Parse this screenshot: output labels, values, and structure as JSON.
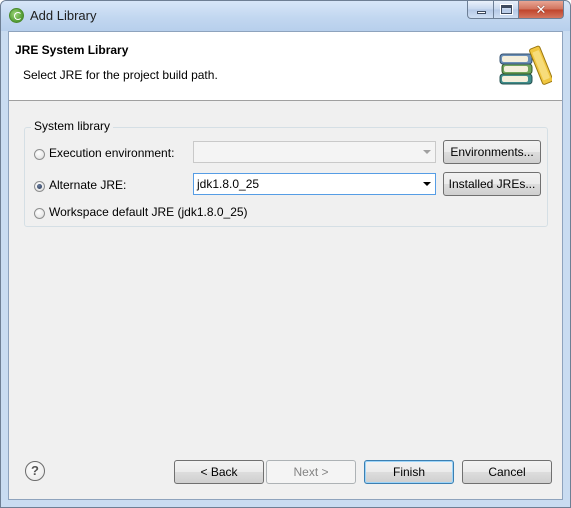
{
  "window": {
    "title": "Add Library",
    "close_glyph": "✕",
    "min_icon": "minimize-icon",
    "max_icon": "maximize-icon"
  },
  "header": {
    "title": "JRE System Library",
    "description": "Select JRE for the project build path.",
    "icon": "books-icon"
  },
  "group": {
    "label": "System library",
    "options": [
      {
        "label": "Execution environment:",
        "checked": false,
        "combo_value": "",
        "combo_enabled": false,
        "button_label": "Environments..."
      },
      {
        "label": "Alternate JRE:",
        "checked": true,
        "combo_value": "jdk1.8.0_25",
        "combo_enabled": true,
        "button_label": "Installed JREs..."
      },
      {
        "label": "Workspace default JRE (jdk1.8.0_25)",
        "checked": false
      }
    ]
  },
  "footer": {
    "help_glyph": "?",
    "back_label": "< Back",
    "next_label": "Next >",
    "finish_label": "Finish",
    "cancel_label": "Cancel"
  },
  "colors": {
    "titlebar": "#c2d7f0",
    "close_button": "#c0432a",
    "dialog_bg": "#f0f0f0",
    "focus_border": "#569de5",
    "default_button_border": "#3c7fb1"
  }
}
